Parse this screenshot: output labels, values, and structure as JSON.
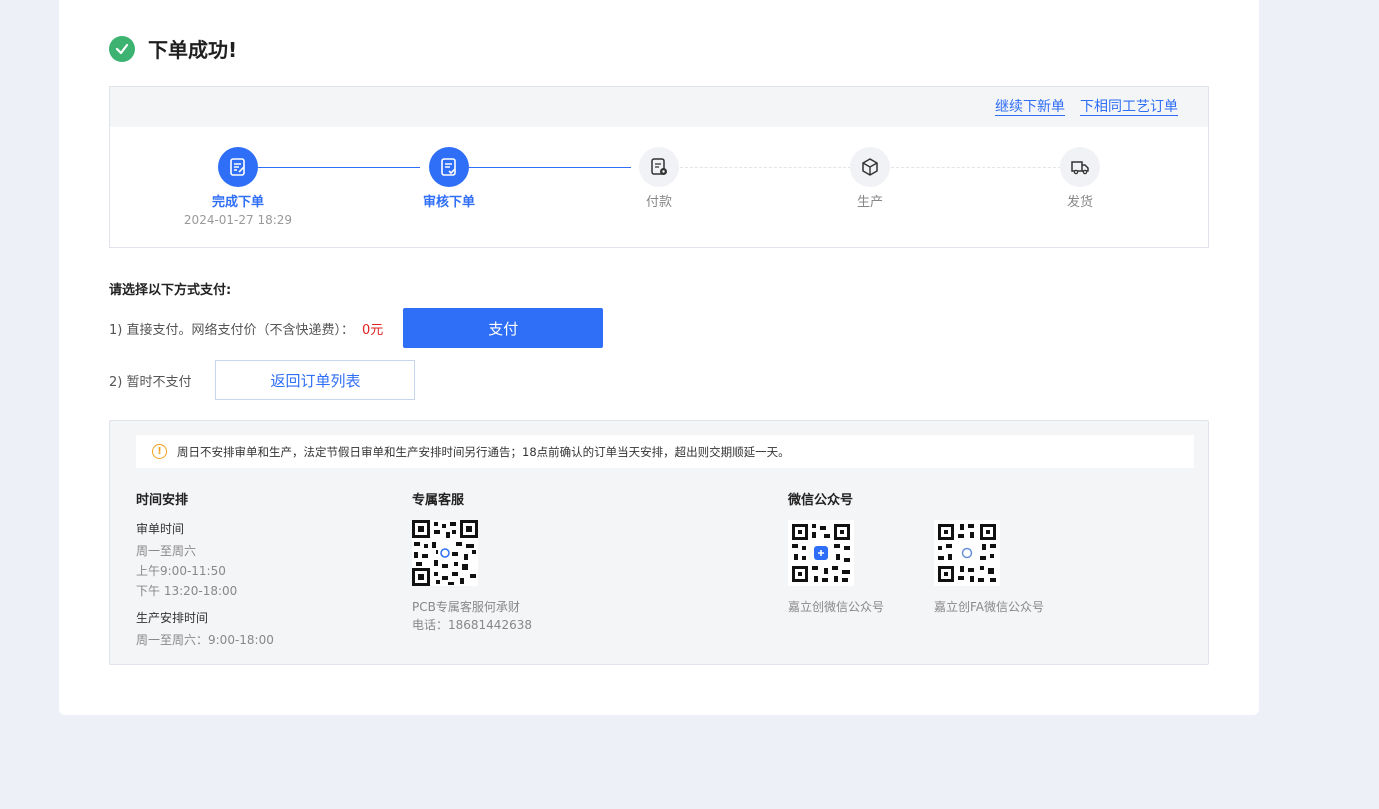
{
  "header": {
    "title": "下单成功!"
  },
  "progress": {
    "links": [
      "继续下新单",
      "下相同工艺订单"
    ],
    "steps": [
      {
        "label": "完成下单",
        "date": "2024-01-27 18:29",
        "status": "done",
        "icon": "order-doc-icon"
      },
      {
        "label": "审核下单",
        "date": "",
        "status": "done",
        "icon": "review-doc-icon"
      },
      {
        "label": "付款",
        "date": "",
        "status": "todo",
        "icon": "payment-doc-icon"
      },
      {
        "label": "生产",
        "date": "",
        "status": "todo",
        "icon": "box-icon"
      },
      {
        "label": "发货",
        "date": "",
        "status": "todo",
        "icon": "truck-icon"
      }
    ]
  },
  "payment": {
    "heading": "请选择以下方式支付:",
    "option1_label": "1)  直接支付。网络支付价（不含快递费）：",
    "option1_price": "0元",
    "pay_button": "支付",
    "option2_label": "2)  暂时不支付",
    "back_button": "返回订单列表"
  },
  "info": {
    "notice": "周日不安排审单和生产，法定节假日审单和生产安排时间另行通告；18点前确认的订单当天安排，超出则交期顺延一天。",
    "schedule": {
      "title": "时间安排",
      "review_title": "审单时间",
      "review_lines": [
        "周一至周六",
        "上午9:00-11:50",
        "下午 13:20-18:00"
      ],
      "production_title": "生产安排时间",
      "production_lines": [
        "周一至周六：9:00-18:00"
      ]
    },
    "service": {
      "title": "专属客服",
      "caption_name": "PCB专属客服何承财",
      "caption_phone": "电话：18681442638"
    },
    "wechat": {
      "title": "微信公众号",
      "qr1_caption": "嘉立创微信公众号",
      "qr2_caption": "嘉立创FA微信公众号"
    }
  },
  "colors": {
    "accent": "#2f6ef6",
    "success": "#3cb371",
    "price": "#e02020",
    "warning": "#f0a020"
  }
}
